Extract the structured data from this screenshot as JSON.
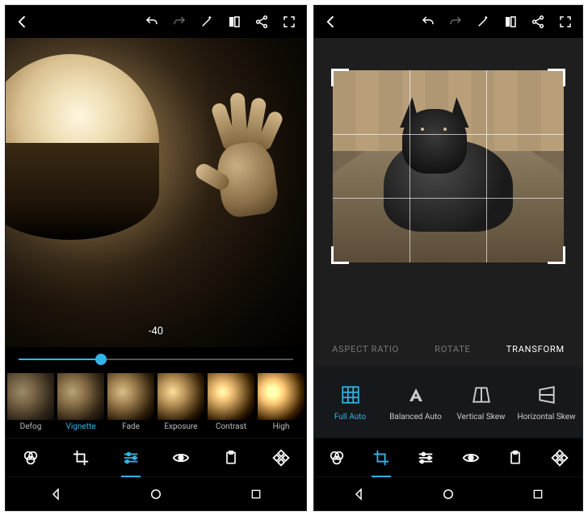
{
  "colors": {
    "accent": "#33b5e5"
  },
  "left": {
    "adjust_value": "-40",
    "slider_percent": 30,
    "filters": [
      {
        "label": "Defog",
        "active": false
      },
      {
        "label": "Vignette",
        "active": true
      },
      {
        "label": "Fade",
        "active": false
      },
      {
        "label": "Exposure",
        "active": false
      },
      {
        "label": "Contrast",
        "active": false
      },
      {
        "label": "High",
        "active": false
      }
    ],
    "tools": [
      {
        "name": "looks"
      },
      {
        "name": "crop"
      },
      {
        "name": "corrections",
        "active": true
      },
      {
        "name": "eye"
      },
      {
        "name": "clipboard"
      },
      {
        "name": "heal"
      }
    ]
  },
  "right": {
    "tabs": [
      {
        "label": "ASPECT RATIO",
        "active": false
      },
      {
        "label": "ROTATE",
        "active": false
      },
      {
        "label": "TRANSFORM",
        "active": true
      }
    ],
    "transform_options": [
      {
        "label": "Full Auto",
        "active": true
      },
      {
        "label": "Balanced Auto",
        "active": false
      },
      {
        "label": "Vertical Skew",
        "active": false
      },
      {
        "label": "Horizontal Skew",
        "active": false
      }
    ],
    "tools": [
      {
        "name": "looks"
      },
      {
        "name": "crop",
        "active": true
      },
      {
        "name": "corrections"
      },
      {
        "name": "eye"
      },
      {
        "name": "clipboard"
      },
      {
        "name": "heal"
      }
    ]
  }
}
